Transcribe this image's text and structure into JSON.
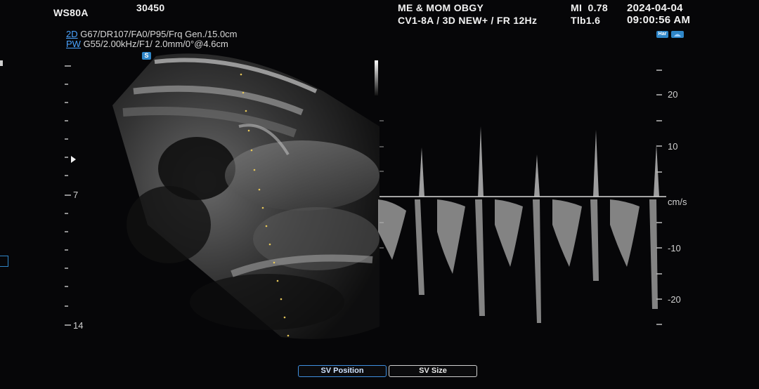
{
  "header": {
    "device": "WS80A",
    "patient_id": "30450",
    "institution": "ME & MOM OBGY",
    "probe_info": "CV1-8A / 3D NEW+ / FR 12Hz",
    "mi": "MI  0.78",
    "tib": "Tlb1.6",
    "date": "2024-04-04",
    "time": "09:00:56 AM"
  },
  "params": {
    "mode_2d": "2D",
    "line_2d": " G67/DR107/FA0/P95/Frq Gen./15.0cm",
    "mode_pw": "PW",
    "line_pw": " G55/2.00kHz/F1/ 2.0mm/0°@4.6cm"
  },
  "badges": {
    "s": "S",
    "har": "Har"
  },
  "depth_scale": {
    "labels": [
      "7",
      "14"
    ]
  },
  "velocity_scale": {
    "labels": [
      "20",
      "10",
      "cm/s",
      "-10",
      "-20"
    ],
    "unit": "cm/s"
  },
  "controls": {
    "sv_position": "SV Position",
    "sv_size": "SV Size"
  },
  "colors": {
    "accent": "#4aa3ff",
    "text": "#e6e6e6",
    "background": "#060608"
  }
}
